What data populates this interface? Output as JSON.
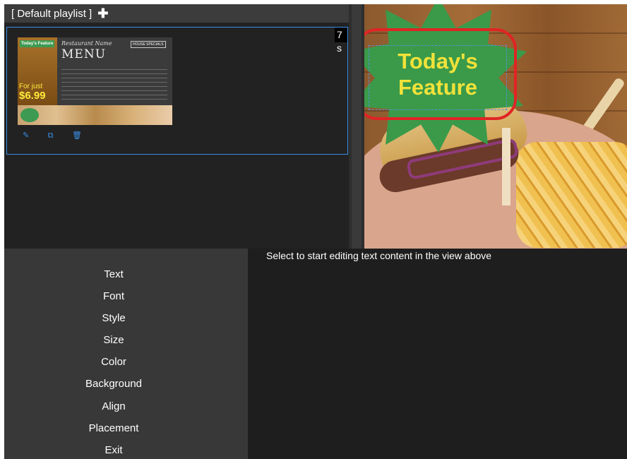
{
  "playlist": {
    "title": "[ Default playlist ]",
    "add_icon": "plus-icon",
    "items": [
      {
        "duration": "7 s",
        "thumbnail": {
          "badge": "Today's Feature",
          "for_just": "For just",
          "price": "$6.99",
          "restaurant_name": "Restaurant Name",
          "menu_title": "MENU",
          "house_specials": "HOUSE SPECIALS"
        },
        "actions": [
          "edit-icon",
          "copy-icon",
          "trash-icon"
        ]
      }
    ]
  },
  "preview": {
    "feature_line1": "Today's",
    "feature_line2": "Feature",
    "highlight_color": "#e02424",
    "text_color": "#f2e23a",
    "badge_color": "#3a9a4a"
  },
  "text_menu": {
    "items": [
      "Text",
      "Font",
      "Style",
      "Size",
      "Color",
      "Background",
      "Align",
      "Placement",
      "Exit"
    ]
  },
  "editor": {
    "hint": "Select to start editing text content in the view above"
  },
  "colors": {
    "accent": "#3a8ee6",
    "panel": "#383838",
    "header": "#3c3c3c"
  }
}
